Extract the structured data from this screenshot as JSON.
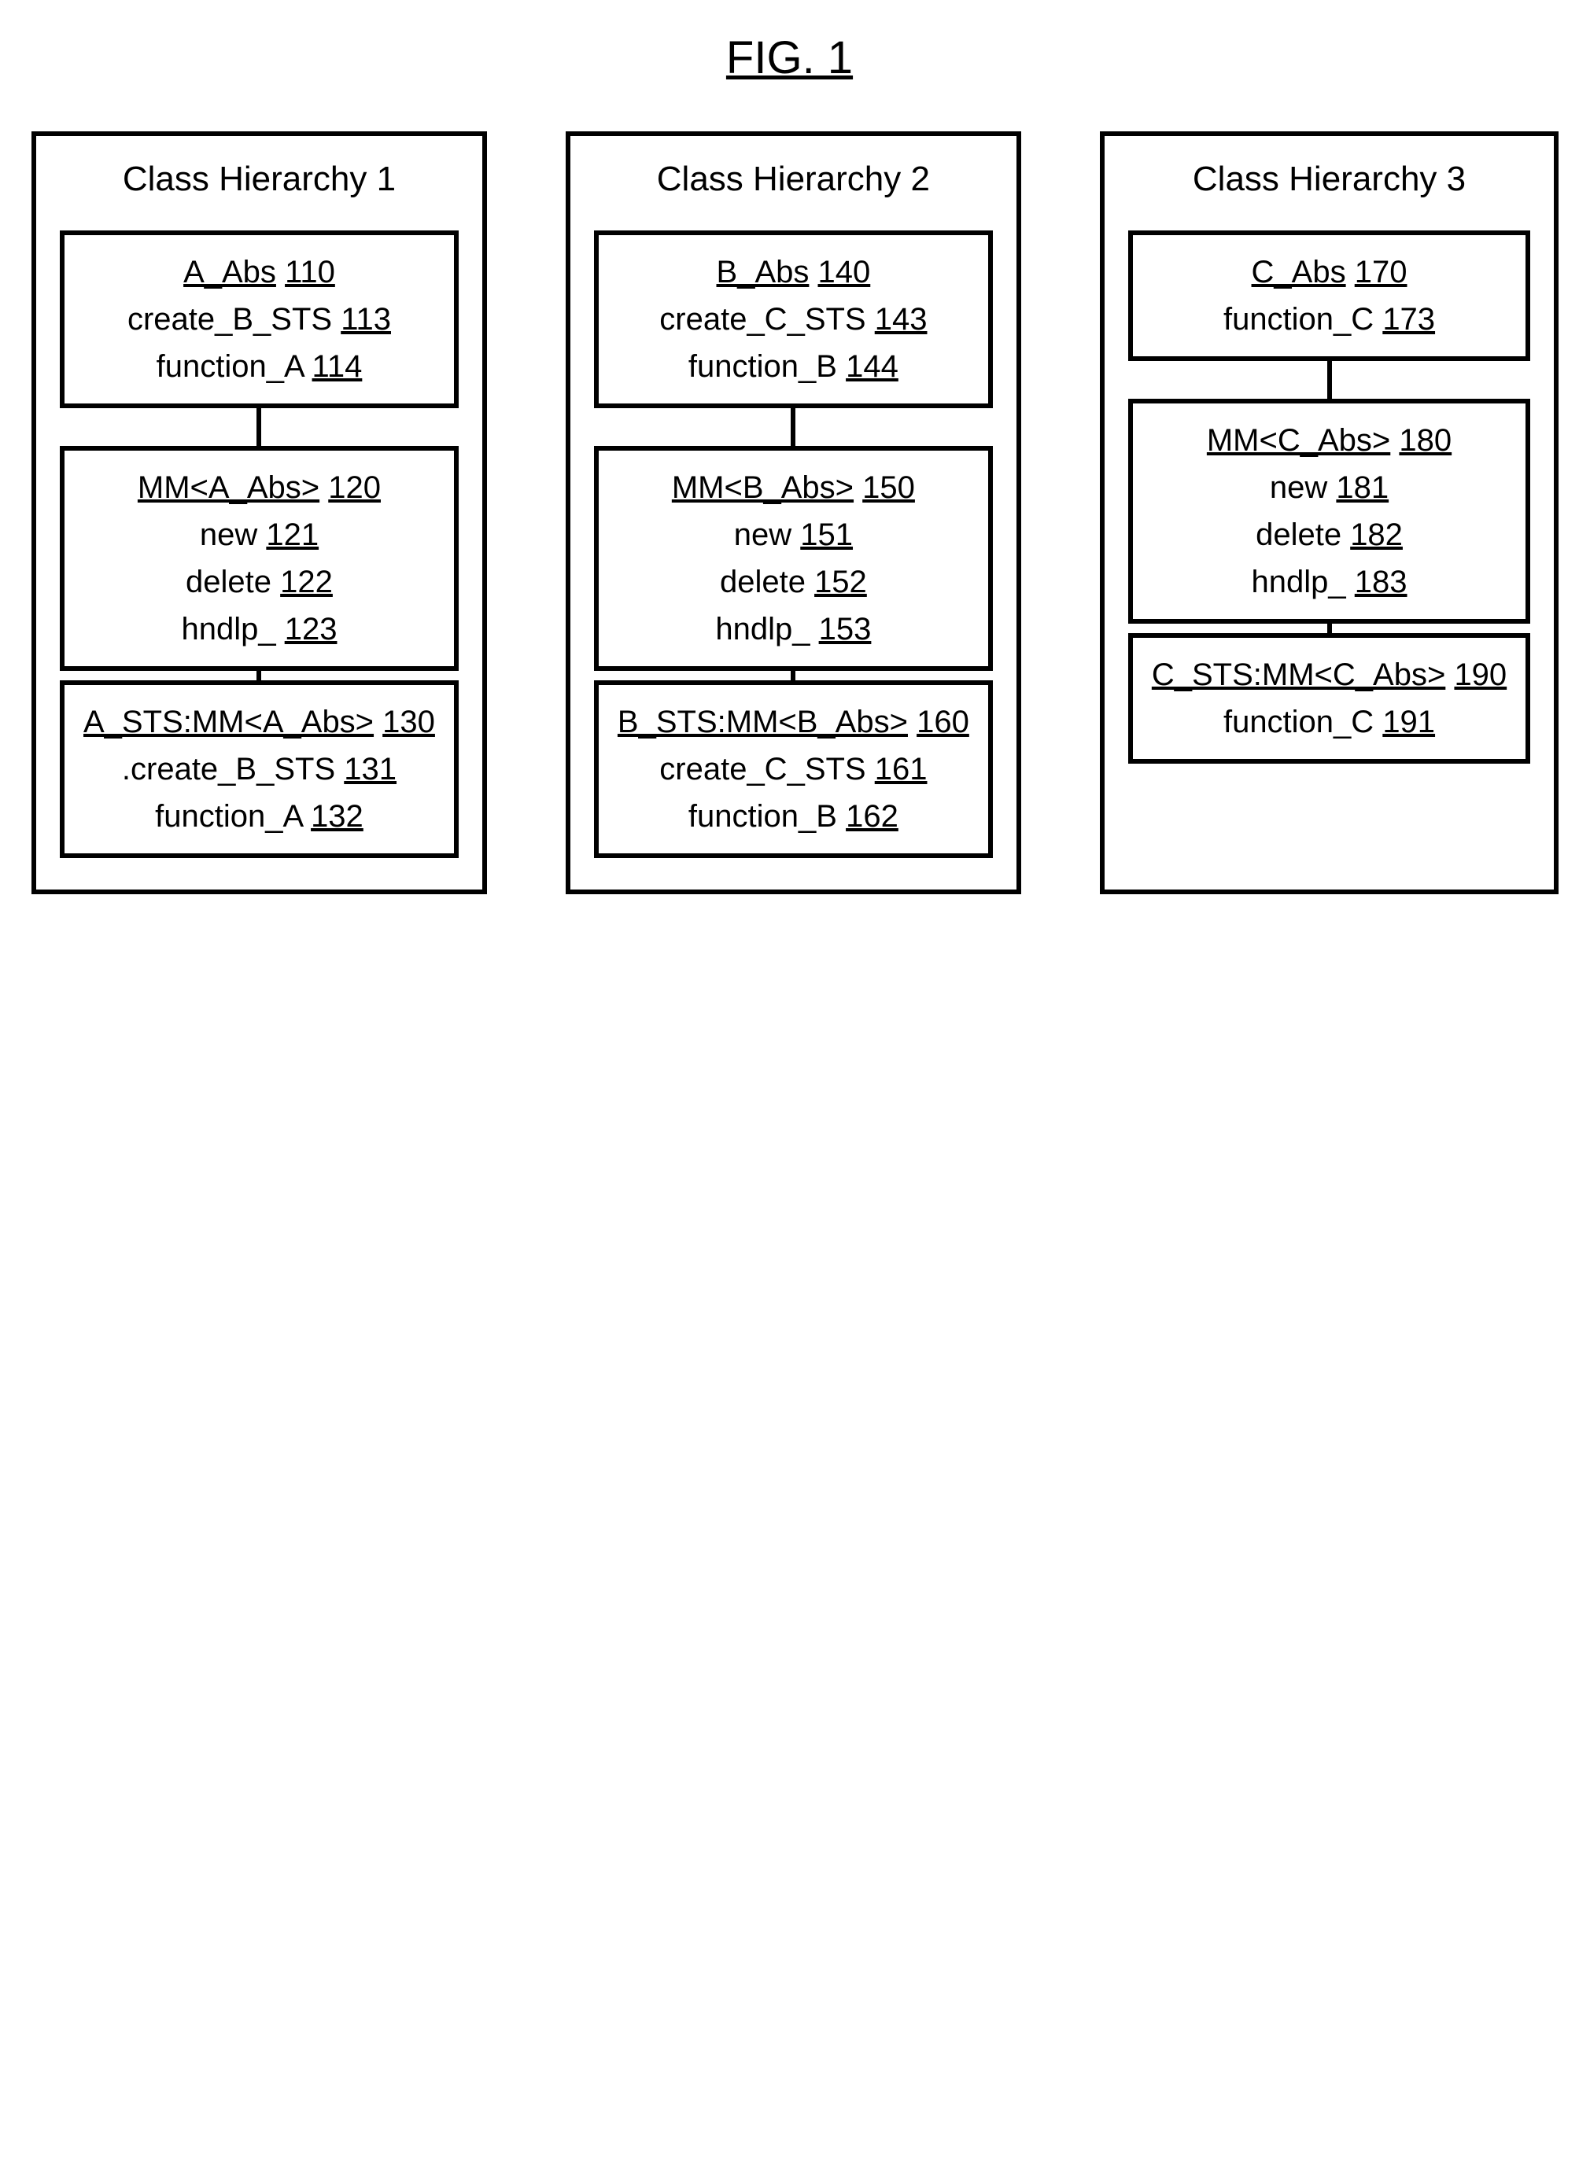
{
  "figure_title": "FIG. 1",
  "hierarchies": [
    {
      "title": "Class Hierarchy 1",
      "boxes": [
        {
          "header": {
            "label": "A_Abs",
            "ref": "110"
          },
          "members": [
            {
              "label": "create_B_STS",
              "ref": "113"
            },
            {
              "label": "function_A",
              "ref": "114"
            }
          ]
        },
        {
          "header": {
            "label": "MM<A_Abs>",
            "ref": "120"
          },
          "members": [
            {
              "label": "new",
              "ref": "121"
            },
            {
              "label": "delete",
              "ref": "122"
            },
            {
              "label": "hndlp_",
              "ref": "123"
            }
          ]
        },
        {
          "header": {
            "label": "A_STS:MM<A_Abs>",
            "ref": "130"
          },
          "members": [
            {
              "label": ".create_B_STS",
              "ref": "131"
            },
            {
              "label": "function_A",
              "ref": "132"
            }
          ]
        }
      ]
    },
    {
      "title": "Class Hierarchy 2",
      "boxes": [
        {
          "header": {
            "label": "B_Abs",
            "ref": "140"
          },
          "members": [
            {
              "label": "create_C_STS",
              "ref": "143"
            },
            {
              "label": "function_B",
              "ref": "144"
            }
          ]
        },
        {
          "header": {
            "label": "MM<B_Abs>",
            "ref": "150"
          },
          "members": [
            {
              "label": "new",
              "ref": "151"
            },
            {
              "label": "delete",
              "ref": "152"
            },
            {
              "label": "hndlp_",
              "ref": "153"
            }
          ]
        },
        {
          "header": {
            "label": "B_STS:MM<B_Abs>",
            "ref": "160"
          },
          "members": [
            {
              "label": "create_C_STS",
              "ref": "161"
            },
            {
              "label": "function_B",
              "ref": "162"
            }
          ]
        }
      ]
    },
    {
      "title": "Class Hierarchy 3",
      "boxes": [
        {
          "header": {
            "label": "C_Abs",
            "ref": "170"
          },
          "members": [
            {
              "label": "function_C",
              "ref": "173"
            }
          ]
        },
        {
          "header": {
            "label": "MM<C_Abs>",
            "ref": "180"
          },
          "members": [
            {
              "label": "new",
              "ref": "181"
            },
            {
              "label": "delete",
              "ref": "182"
            },
            {
              "label": "hndlp_",
              "ref": "183"
            }
          ]
        },
        {
          "header": {
            "label": "C_STS:MM<C_Abs>",
            "ref": "190"
          },
          "members": [
            {
              "label": "function_C",
              "ref": "191"
            }
          ]
        }
      ]
    }
  ]
}
